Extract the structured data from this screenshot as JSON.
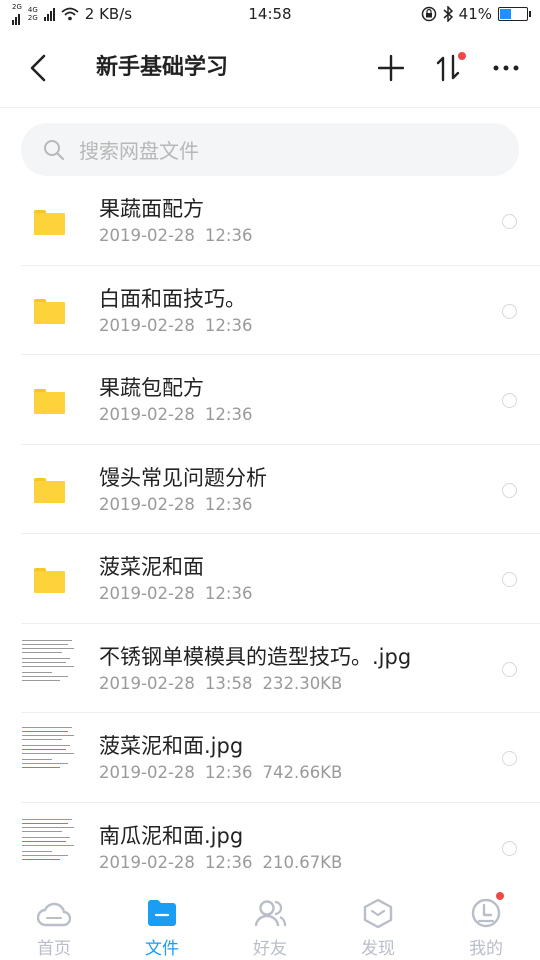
{
  "status_bar": {
    "network_top": "2G",
    "network_mid": "4G",
    "network_bottom": "2G",
    "speed": "2 KB/s",
    "time": "14:58",
    "battery_percent": "41%",
    "battery_level": 0.41,
    "battery_color": "#1e90ff"
  },
  "header": {
    "title": "新手基础学习",
    "back_icon": "chevron-left-icon",
    "add_icon": "plus-icon",
    "sort_icon": "transfer-arrows-icon",
    "more_icon": "more-dots-icon",
    "badge_color": "#f04848"
  },
  "search": {
    "placeholder": "搜索网盘文件",
    "icon": "search-icon"
  },
  "files": [
    {
      "type": "folder",
      "name": "果蔬面配方",
      "date": "2019-02-28",
      "time": "12:36",
      "size": ""
    },
    {
      "type": "folder",
      "name": "白面和面技巧。",
      "date": "2019-02-28",
      "time": "12:36",
      "size": ""
    },
    {
      "type": "folder",
      "name": "果蔬包配方",
      "date": "2019-02-28",
      "time": "12:36",
      "size": ""
    },
    {
      "type": "folder",
      "name": "馒头常见问题分析",
      "date": "2019-02-28",
      "time": "12:36",
      "size": ""
    },
    {
      "type": "folder",
      "name": "菠菜泥和面",
      "date": "2019-02-28",
      "time": "12:36",
      "size": ""
    },
    {
      "type": "image",
      "name": "不锈钢单模模具的造型技巧。.jpg",
      "date": "2019-02-28",
      "time": "13:58",
      "size": "232.30KB"
    },
    {
      "type": "image",
      "name": "菠菜泥和面.jpg",
      "date": "2019-02-28",
      "time": "12:36",
      "size": "742.66KB"
    },
    {
      "type": "image",
      "name": "南瓜泥和面.jpg",
      "date": "2019-02-28",
      "time": "12:36",
      "size": "210.67KB"
    }
  ],
  "tabs": [
    {
      "label": "首页",
      "icon": "cloud-icon",
      "active": false
    },
    {
      "label": "文件",
      "icon": "folder-icon",
      "active": true
    },
    {
      "label": "好友",
      "icon": "friends-icon",
      "active": false
    },
    {
      "label": "发现",
      "icon": "discover-icon",
      "active": false
    },
    {
      "label": "我的",
      "icon": "profile-icon",
      "active": false
    }
  ],
  "colors": {
    "accent": "#1a9df5",
    "inactive": "#b9bec8",
    "folder": "#fdd23a"
  }
}
